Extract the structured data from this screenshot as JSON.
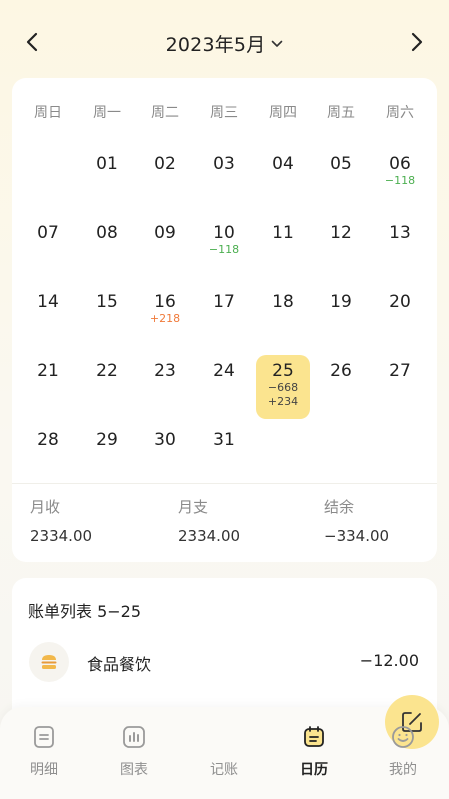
{
  "header": {
    "month_label": "2023年5月"
  },
  "weekdays": [
    "周日",
    "周一",
    "周二",
    "周三",
    "周四",
    "周五",
    "周六"
  ],
  "calendar": [
    {
      "day": "01",
      "col": 1,
      "row": 0
    },
    {
      "day": "02",
      "col": 2,
      "row": 0
    },
    {
      "day": "03",
      "col": 3,
      "row": 0
    },
    {
      "day": "04",
      "col": 4,
      "row": 0
    },
    {
      "day": "05",
      "col": 5,
      "row": 0
    },
    {
      "day": "06",
      "col": 6,
      "row": 0,
      "amounts": [
        {
          "text": "−118",
          "type": "neg"
        }
      ]
    },
    {
      "day": "07",
      "col": 0,
      "row": 1
    },
    {
      "day": "08",
      "col": 1,
      "row": 1
    },
    {
      "day": "09",
      "col": 2,
      "row": 1
    },
    {
      "day": "10",
      "col": 3,
      "row": 1,
      "amounts": [
        {
          "text": "−118",
          "type": "neg"
        }
      ]
    },
    {
      "day": "11",
      "col": 4,
      "row": 1
    },
    {
      "day": "12",
      "col": 5,
      "row": 1
    },
    {
      "day": "13",
      "col": 6,
      "row": 1
    },
    {
      "day": "14",
      "col": 0,
      "row": 2
    },
    {
      "day": "15",
      "col": 1,
      "row": 2
    },
    {
      "day": "16",
      "col": 2,
      "row": 2,
      "amounts": [
        {
          "text": "+218",
          "type": "pos"
        }
      ]
    },
    {
      "day": "17",
      "col": 3,
      "row": 2
    },
    {
      "day": "18",
      "col": 4,
      "row": 2
    },
    {
      "day": "19",
      "col": 5,
      "row": 2
    },
    {
      "day": "20",
      "col": 6,
      "row": 2
    },
    {
      "day": "21",
      "col": 0,
      "row": 3
    },
    {
      "day": "22",
      "col": 1,
      "row": 3
    },
    {
      "day": "23",
      "col": 2,
      "row": 3
    },
    {
      "day": "24",
      "col": 3,
      "row": 3
    },
    {
      "day": "25",
      "col": 4,
      "row": 3,
      "today": true,
      "amounts": [
        {
          "text": "−668",
          "type": "neg"
        },
        {
          "text": "+234",
          "type": "pos"
        }
      ]
    },
    {
      "day": "26",
      "col": 5,
      "row": 3
    },
    {
      "day": "27",
      "col": 6,
      "row": 3
    },
    {
      "day": "28",
      "col": 0,
      "row": 4
    },
    {
      "day": "29",
      "col": 1,
      "row": 4
    },
    {
      "day": "30",
      "col": 2,
      "row": 4
    },
    {
      "day": "31",
      "col": 3,
      "row": 4
    }
  ],
  "summary": {
    "income_label": "月收",
    "income_value": "2334.00",
    "expense_label": "月支",
    "expense_value": "2334.00",
    "balance_label": "结余",
    "balance_value": "−334.00"
  },
  "bill_list": {
    "title": "账单列表 5−25",
    "items": [
      {
        "category": "食品餐饮",
        "amount": "−12.00",
        "icon": "burger-icon"
      }
    ]
  },
  "tabs": [
    {
      "key": "detail",
      "label": "明细",
      "icon": "list-icon"
    },
    {
      "key": "chart",
      "label": "图表",
      "icon": "chart-icon"
    },
    {
      "key": "record",
      "label": "记账",
      "icon": "edit-icon"
    },
    {
      "key": "calendar",
      "label": "日历",
      "icon": "calendar-icon",
      "active": true
    },
    {
      "key": "mine",
      "label": "我的",
      "icon": "smile-icon"
    }
  ],
  "colors": {
    "accent": "#fbe48f",
    "expense": "#4caf50",
    "income": "#f07a3a"
  }
}
